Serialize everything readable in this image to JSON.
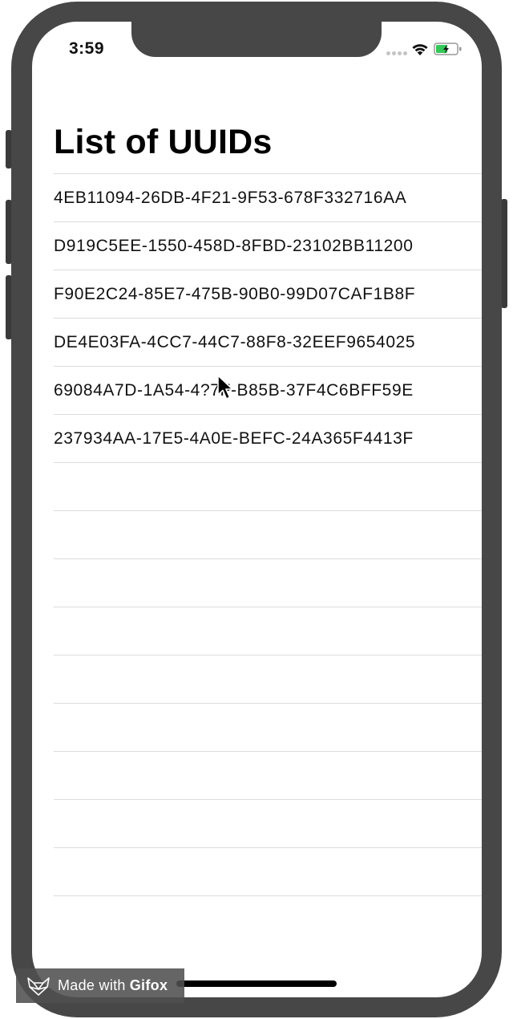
{
  "status_bar": {
    "time": "3:59",
    "battery_color": "#34c759"
  },
  "page": {
    "title": "List of UUIDs"
  },
  "uuids": [
    "4EB11094-26DB-4F21-9F53-678F332716AA",
    "D919C5EE-1550-458D-8FBD-23102BB11200",
    "F90E2C24-85E7-475B-90B0-99D07CAF1B8F",
    "DE4E03FA-4CC7-44C7-88F8-32EEF9654025",
    "69084A7D-1A54-4?7F-B85B-37F4C6BFF59E",
    "237934AA-17E5-4A0E-BEFC-24A365F4413F"
  ],
  "empty_row_count": 10,
  "watermark": {
    "prefix": "Made with",
    "brand": "Gifox"
  }
}
